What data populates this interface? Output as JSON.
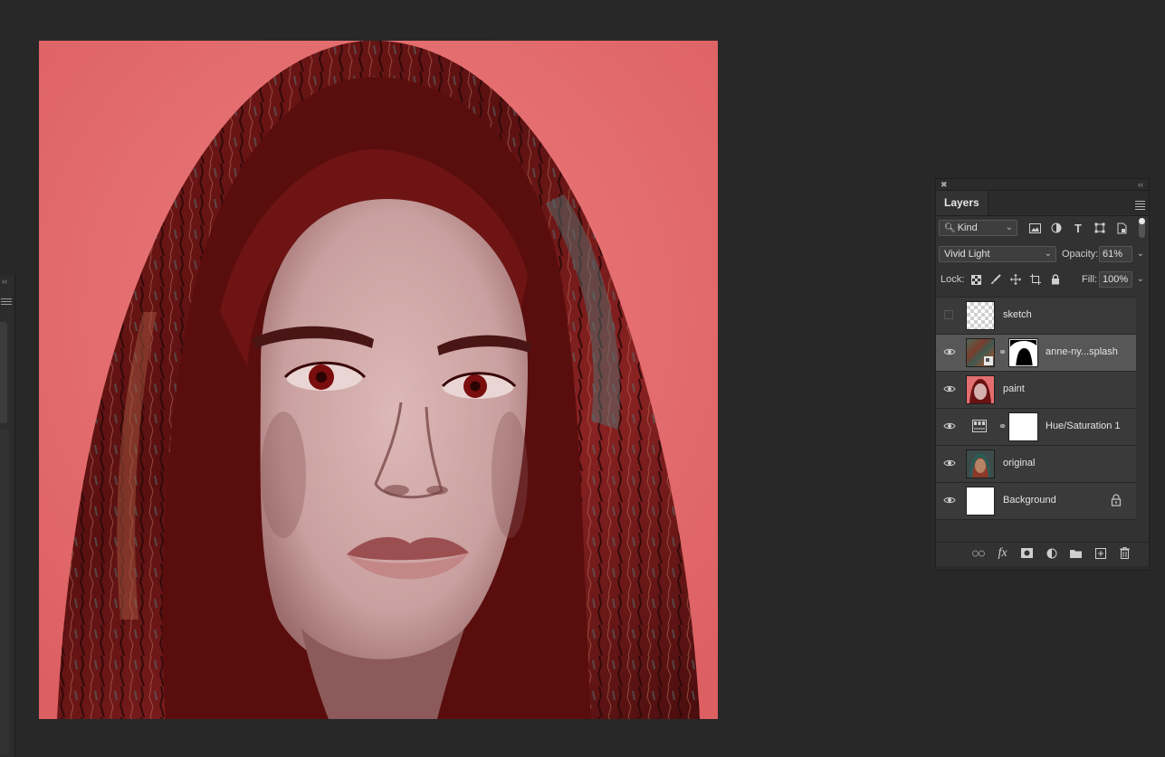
{
  "panel": {
    "tab_label": "Layers",
    "filter_kind": "Kind",
    "blend_mode": "Vivid Light",
    "opacity_label": "Opacity:",
    "opacity_value": "61%",
    "lock_label": "Lock:",
    "fill_label": "Fill:",
    "fill_value": "100%"
  },
  "layers": [
    {
      "name": "sketch",
      "visible": false,
      "thumb": "transparent"
    },
    {
      "name": "anne-ny...splash",
      "visible": true,
      "thumb": "texture",
      "mask": true,
      "selected": true
    },
    {
      "name": "paint",
      "visible": true,
      "thumb": "portrait-paint"
    },
    {
      "name": "Hue/Saturation 1",
      "visible": true,
      "thumb": "adjustment",
      "mask": true
    },
    {
      "name": "original",
      "visible": true,
      "thumb": "portrait-original"
    },
    {
      "name": "Background",
      "visible": true,
      "thumb": "white",
      "locked": true
    }
  ],
  "colors": {
    "canvas_bg": "#e36e6f",
    "panel_bg": "#323232",
    "app_bg": "#282828",
    "selected_layer": "#575757"
  }
}
